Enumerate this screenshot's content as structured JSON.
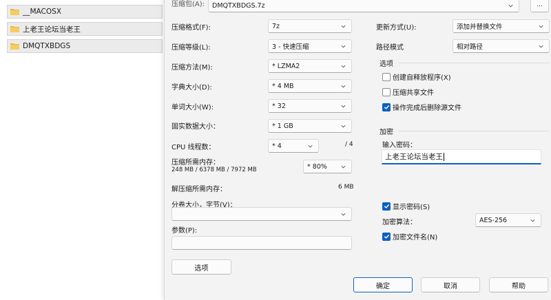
{
  "file_list": [
    {
      "name": "__MACOSX"
    },
    {
      "name": "上老王论坛当老王"
    },
    {
      "name": "DMQTXBDGS"
    }
  ],
  "archive": {
    "label": "压缩包(A):",
    "value": "DMQTXBDGS.7z",
    "browse_label": "..."
  },
  "left": {
    "format": {
      "label": "压缩格式(F):",
      "value": "7z"
    },
    "level": {
      "label": "压缩等级(L):",
      "value": "3 - 快速压缩"
    },
    "method": {
      "label": "压缩方法(M):",
      "value": "* LZMA2"
    },
    "dict": {
      "label": "字典大小(D):",
      "value": "* 4 MB"
    },
    "word": {
      "label": "单词大小(W):",
      "value": "* 32"
    },
    "solid": {
      "label": "固实数据大小：",
      "value": "* 1 GB"
    },
    "cpu": {
      "label": "CPU 线程数：",
      "value": "* 4",
      "max": "/ 4"
    },
    "mem_compress": {
      "label": "压缩所需内存：",
      "detail": "248 MB / 6378 MB / 7972 MB",
      "value": "* 80%"
    },
    "mem_decompress": {
      "label": "解压缩所需内存：",
      "value": "6 MB"
    },
    "split": {
      "label": "分卷大小，字节(V)：",
      "value": ""
    },
    "params": {
      "label": "参数(P):",
      "value": ""
    },
    "options_button": "选项"
  },
  "right": {
    "update": {
      "label": "更新方式(U):",
      "value": "添加并替换文件"
    },
    "path": {
      "label": "路径模式",
      "value": "相对路径"
    },
    "options_group": {
      "title": "选项",
      "sfx": {
        "label": "创建自释放程序(X)",
        "checked": false
      },
      "shared": {
        "label": "压缩共享文件",
        "checked": false
      },
      "delete": {
        "label": "操作完成后删除源文件",
        "checked": true
      }
    },
    "encrypt_group": {
      "title": "加密",
      "password_label": "输入密码：",
      "password_value": "上老王论坛当老王",
      "show_password": {
        "label": "显示密码(S)",
        "checked": true
      },
      "method_label": "加密算法：",
      "method_value": "AES-256",
      "encrypt_names": {
        "label": "加密文件名(N)",
        "checked": true
      }
    }
  },
  "buttons": {
    "ok": "确定",
    "cancel": "取消",
    "help": "帮助"
  },
  "colors": {
    "accent": "#0a5fc4",
    "folder": "#e8b84a"
  }
}
